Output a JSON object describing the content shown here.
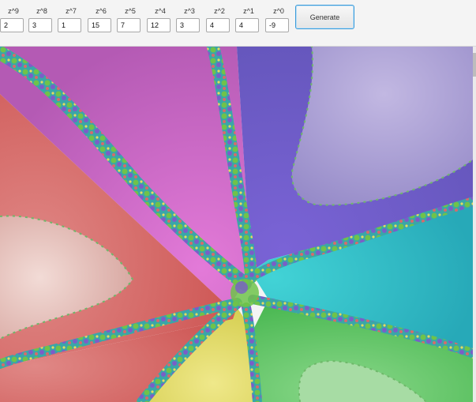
{
  "coefficients": [
    {
      "label": "z^9",
      "value": "2"
    },
    {
      "label": "z^8",
      "value": "3"
    },
    {
      "label": "z^7",
      "value": "1"
    },
    {
      "label": "z^6",
      "value": "15"
    },
    {
      "label": "z^5",
      "value": "7"
    },
    {
      "label": "z^4",
      "value": "12"
    },
    {
      "label": "z^3",
      "value": "3"
    },
    {
      "label": "z^2",
      "value": "4"
    },
    {
      "label": "z^1",
      "value": "4"
    },
    {
      "label": "z^0",
      "value": "-9"
    }
  ],
  "generate_label": "Generate",
  "fractal": {
    "colors": {
      "red": "#cf5a58",
      "pale_rose": "#e4c2bd",
      "magenta": "#d46ac6",
      "violet": "#6e5cc7",
      "lavender": "#a89ad0",
      "cyan": "#2cc6c9",
      "green": "#55c55a",
      "yellow": "#e2dc62",
      "boundary": "#3aa6a8"
    }
  }
}
